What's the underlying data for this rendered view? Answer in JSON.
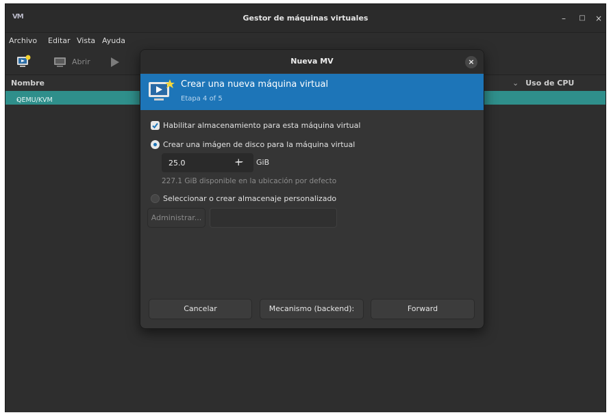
{
  "window": {
    "logo": "VM",
    "title": "Gestor de máquinas virtuales",
    "minimize": "–",
    "maximize": "□",
    "close": "×"
  },
  "menu": [
    "Archivo",
    "Editar",
    "Vista",
    "Ayuda"
  ],
  "toolbar": {
    "open_label": "Abrir"
  },
  "columns": {
    "name": "Nombre",
    "cpu": "Uso de CPU",
    "cpu_chevron": "⌄"
  },
  "connections": [
    {
      "label": "QEMU/KVM",
      "chevron": "›"
    }
  ],
  "dialog": {
    "title": "Nueva MV",
    "close": "×",
    "banner": {
      "heading": "Crear una nueva máquina virtual",
      "step": "Etapa 4 of 5"
    },
    "enable_storage": {
      "label": "Habilitar almacenamiento para esta máquina virtual",
      "checked": true
    },
    "create_disk": {
      "label": "Crear una imágen de disco para la máquina virtual",
      "selected": true
    },
    "disk_size": {
      "value": "25.0",
      "unit": "GiB",
      "minus": "−",
      "plus": "+"
    },
    "available_hint": "227.1 GiB disponible en la ubicación por defecto",
    "custom_storage": {
      "label": "Seleccionar o crear almacenaje personalizado",
      "selected": false
    },
    "manage_button": "Administrar...",
    "path_value": "",
    "buttons": {
      "cancel": "Cancelar",
      "backend": "Mecanismo (backend):",
      "forward": "Forward"
    }
  },
  "colors": {
    "accent": "#1d75b8",
    "selection": "#2f8f8b",
    "background": "#303030"
  }
}
